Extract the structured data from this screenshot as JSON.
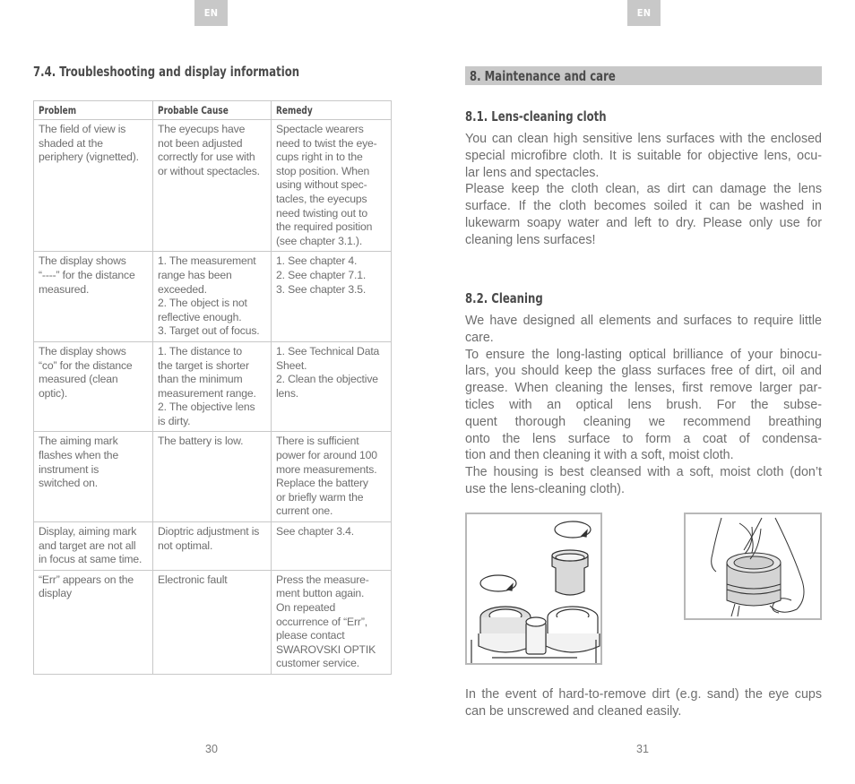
{
  "left_page": {
    "lang_tab": "EN",
    "section_title": "7.4. Troubleshooting and display information",
    "table": {
      "headers": [
        "Problem",
        "Probable Cause",
        "Remedy"
      ],
      "rows": [
        {
          "problem": [
            "The field of view is",
            "shaded at the",
            "periphery (vignetted)."
          ],
          "cause": [
            "The eyecups have",
            "not been adjusted",
            "correctly for use with",
            "or without spectacles."
          ],
          "remedy": [
            "Spectacle wearers",
            "need to twist the eye-",
            "cups right in to the",
            "stop position. When",
            "using without spec-",
            "tacles, the eyecups",
            "need twisting out to",
            "the required position",
            "(see chapter 3.1.)."
          ]
        },
        {
          "problem": [
            "The display shows",
            "“----” for the distance",
            "measured."
          ],
          "cause": [
            "1. The measurement",
            "range has been",
            "exceeded.",
            "2. The object is not",
            "reflective enough.",
            "3. Target out of focus."
          ],
          "remedy": [
            "1. See chapter 4.",
            "2. See chapter 7.1.",
            "3. See chapter 3.5."
          ]
        },
        {
          "problem": [
            "The display shows",
            "“co” for the distance",
            "measured (clean",
            "optic)."
          ],
          "cause": [
            "1. The distance to",
            "the target is shorter",
            "than the minimum",
            "measurement range.",
            "2. The objective lens",
            "is dirty."
          ],
          "remedy": [
            "1. See Technical Data",
            "Sheet.",
            "2. Clean the objective",
            "lens."
          ]
        },
        {
          "problem": [
            "The aiming mark",
            "flashes when the",
            "instrument is",
            "switched on."
          ],
          "cause": [
            "The battery is low."
          ],
          "remedy": [
            "There is sufficient",
            "power for around 100",
            "more measurements.",
            "Replace the battery",
            "or briefly warm the",
            "current one."
          ]
        },
        {
          "problem": [
            "Display, aiming mark",
            "and target are not all",
            "in focus at same time."
          ],
          "cause": [
            "Dioptric adjustment is",
            "not optimal."
          ],
          "remedy": [
            "See chapter 3.4."
          ]
        },
        {
          "problem": [
            "“Err” appears on the",
            "display"
          ],
          "cause": [
            "Electronic fault"
          ],
          "remedy": [
            "Press the measure-",
            "ment button again.",
            "On repeated",
            "occurrence of “Err”,",
            "please contact",
            "SWAROVSKI OPTIK",
            "customer service."
          ]
        }
      ]
    },
    "page_number": "30"
  },
  "right_page": {
    "lang_tab": "EN",
    "section_title": "8. Maintenance and care",
    "subsections": [
      {
        "title": "8.1. Lens-cleaning cloth",
        "lines": [
          "You can clean high sensitive lens surfaces with the enclosed",
          "special microfibre cloth. It is suitable for objective lens, ocu-",
          "lar lens and spectacles.",
          "Please keep the cloth clean, as dirt can damage the lens",
          "surface. If the cloth becomes soiled it can be washed in",
          "lukewarm soapy water and left to dry. Please only use for",
          "cleaning lens surfaces!"
        ]
      },
      {
        "title": "8.2. Cleaning",
        "lines": [
          "We have designed all elements and surfaces to require little",
          "care.",
          "To ensure the long-lasting optical brilliance of your binocu-",
          "lars, you should keep the glass surfaces free of dirt, oil and",
          "grease. When cleaning the lenses, first remove larger par-",
          "ticles with an optical lens brush. For the subse-",
          "quent thorough cleaning we recommend breathing",
          "onto the lens surface to form a coat of condensa-",
          "tion and then cleaning it with a soft, moist cloth.",
          "The housing is best cleansed with a soft, moist cloth (don’t",
          "use the lens-cleaning cloth)."
        ]
      }
    ],
    "figures": [
      {
        "name": "eyecup-removal-illustration",
        "label": "binoculars-eyecup-unscrew-icon"
      },
      {
        "name": "eyecup-cleaning-illustration",
        "label": "hand-cleaning-eyecup-icon"
      }
    ],
    "closing_lines": [
      "In the event of hard-to-remove dirt (e.g. sand) the eye cups",
      "can be unscrewed and cleaned easily."
    ],
    "page_number": "31"
  }
}
